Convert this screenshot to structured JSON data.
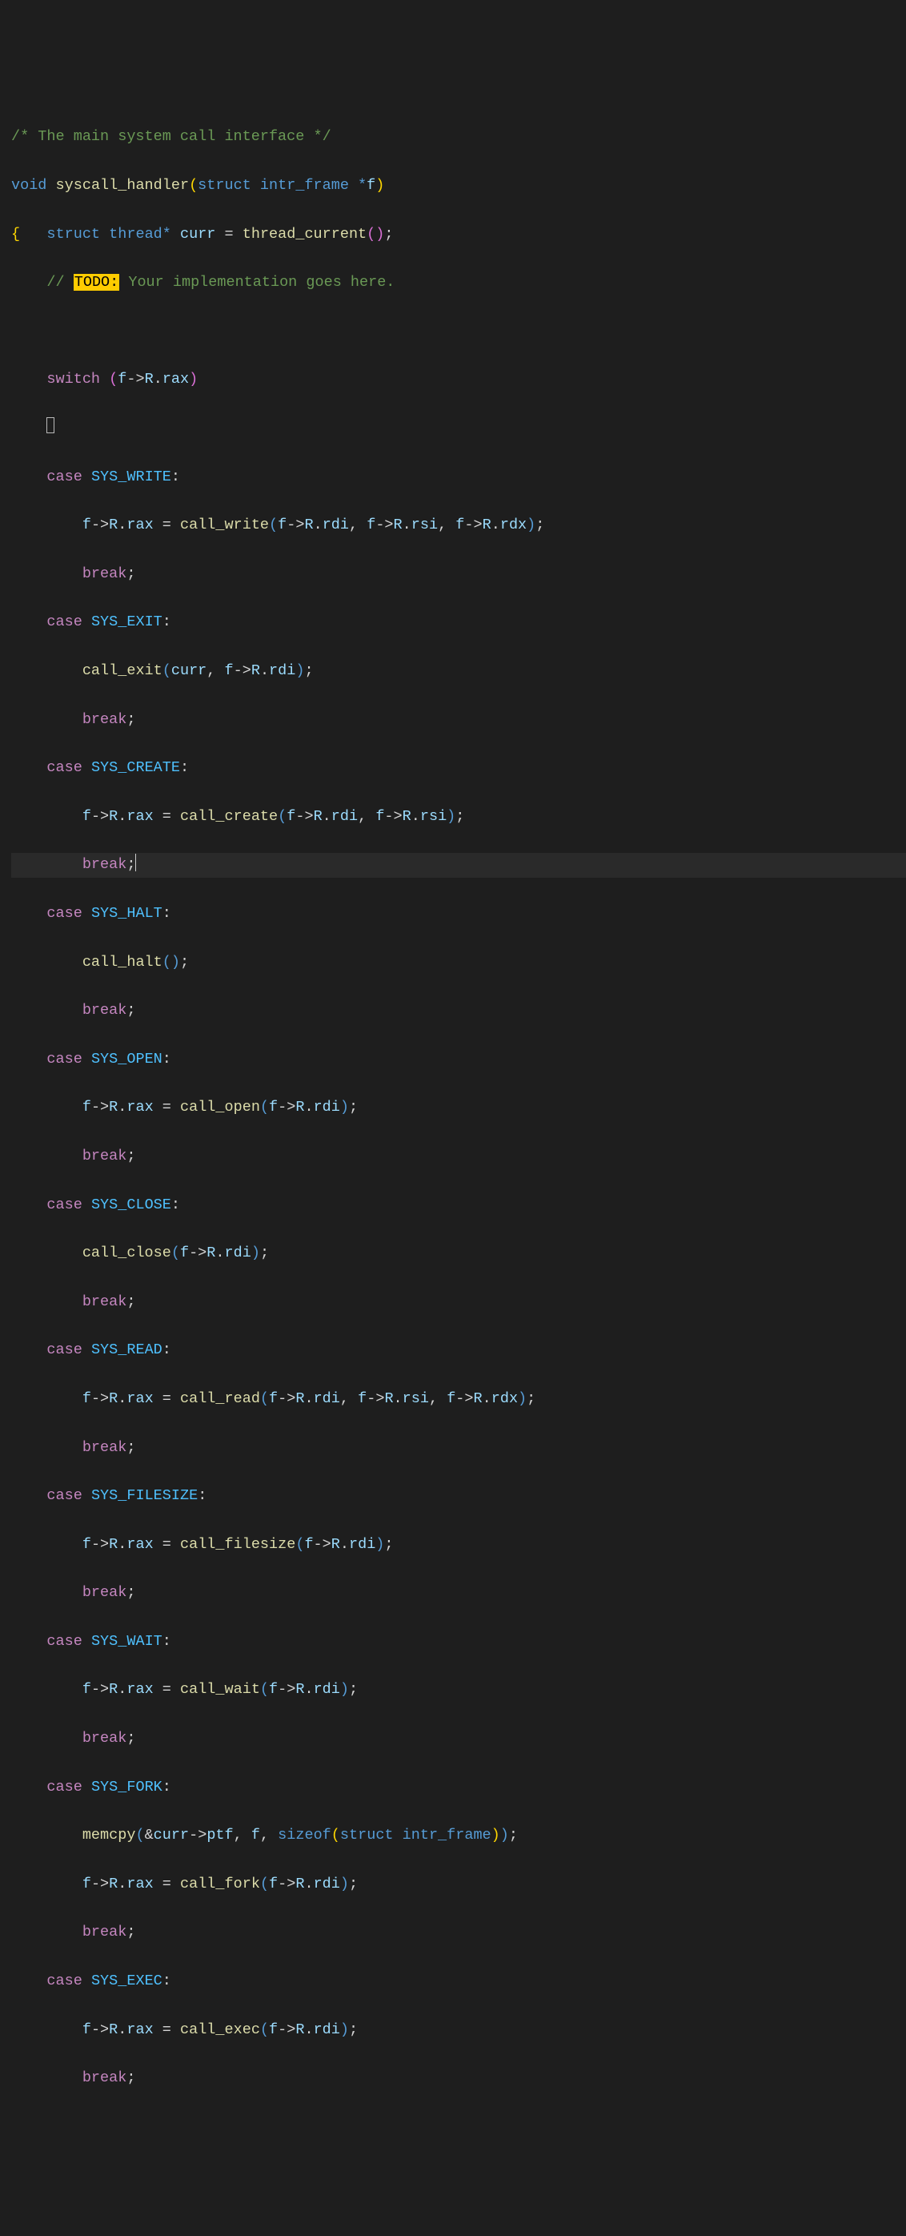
{
  "code": {
    "comment_top": "/* The main system call interface */",
    "fn_decl": {
      "ret": "void",
      "name": "syscall_handler",
      "param_kw": "struct",
      "param_type": "intr_frame",
      "param_star": "*",
      "param_name": "f"
    },
    "local": {
      "kw": "struct",
      "type": "thread",
      "star": "*",
      "name": "curr",
      "assign": " = ",
      "call": "thread_current",
      "parens": "()",
      "semi": ";"
    },
    "todo": {
      "slashes": "// ",
      "tag": "TODO:",
      "rest": " Your implementation goes here."
    },
    "switch_kw": "switch",
    "switch_expr": {
      "f": "f",
      "arrow": "->",
      "R": "R",
      "dot": ".",
      "rax": "rax"
    },
    "case_kw": "case",
    "break_kw": "break",
    "sizeof_kw": "sizeof",
    "struct_kw": "struct",
    "intr_frame": "intr_frame",
    "amp": "&",
    "ptf": "ptf",
    "comma": ", ",
    "f_id": "f",
    "curr_id": "curr",
    "cases": {
      "write": {
        "enum": "SYS_WRITE",
        "call": "call_write",
        "args": "f->R.rdi, f->R.rsi, f->R.rdx",
        "assign": true
      },
      "exit": {
        "enum": "SYS_EXIT",
        "call": "call_exit",
        "args": "curr, f->R.rdi",
        "assign": false
      },
      "create": {
        "enum": "SYS_CREATE",
        "call": "call_create",
        "args": "f->R.rdi, f->R.rsi",
        "assign": true
      },
      "halt": {
        "enum": "SYS_HALT",
        "call": "call_halt",
        "args": "",
        "assign": false
      },
      "open": {
        "enum": "SYS_OPEN",
        "call": "call_open",
        "args": "f->R.rdi",
        "assign": true
      },
      "close": {
        "enum": "SYS_CLOSE",
        "call": "call_close",
        "args": "f->R.rdi",
        "assign": false
      },
      "read": {
        "enum": "SYS_READ",
        "call": "call_read",
        "args": "f->R.rdi, f->R.rsi, f->R.rdx",
        "assign": true
      },
      "filesize": {
        "enum": "SYS_FILESIZE",
        "call": "call_filesize",
        "args": "f->R.rdi",
        "assign": true
      },
      "wait": {
        "enum": "SYS_WAIT",
        "call": "call_wait",
        "args": "f->R.rdi",
        "assign": true
      },
      "fork": {
        "enum": "SYS_FORK",
        "call": "call_fork",
        "args": "f->R.rdi",
        "assign": true
      },
      "exec": {
        "enum": "SYS_EXEC",
        "call": "call_exec",
        "args": "f->R.rdi",
        "assign": true
      }
    },
    "memcpy_call": "memcpy",
    "fR_rax": "f->R.rax",
    "eq": " = "
  }
}
